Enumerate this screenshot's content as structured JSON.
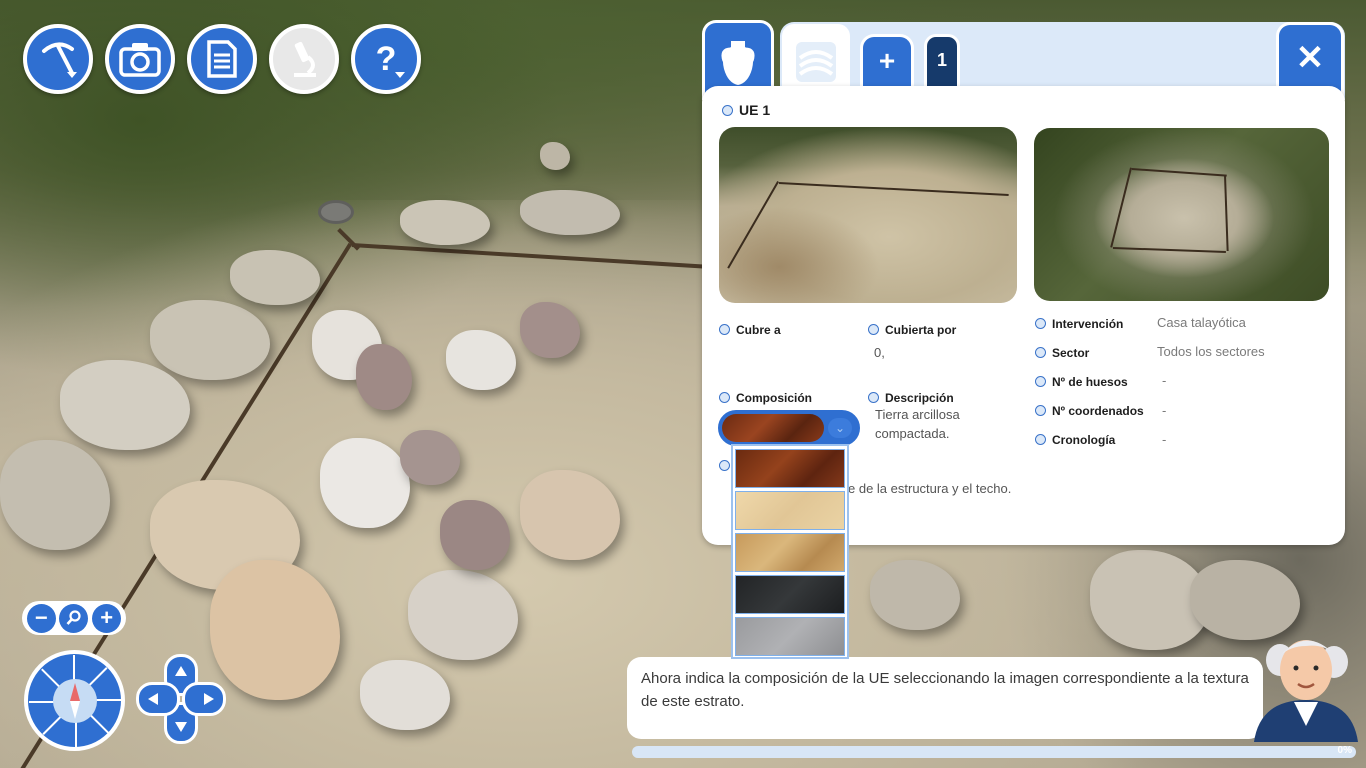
{
  "toolbar": {
    "excavate_icon": "pickaxe-icon",
    "camera_icon": "camera-icon",
    "records_icon": "document-icon",
    "microscope_icon": "microscope-icon",
    "help_icon": "question-icon",
    "help_label": "?"
  },
  "zoom": {
    "minus_label": "−",
    "plus_label": "+",
    "search_icon": "magnifier-icon"
  },
  "record_panel": {
    "tabs": {
      "ue_icon": "amphora-icon",
      "layers_icon": "layers-icon",
      "add_label": "+",
      "number_label": "1",
      "close_label": "✕"
    },
    "title": "UE 1",
    "fields": {
      "cubre_a": {
        "label": "Cubre a",
        "value": ""
      },
      "cubierta_por": {
        "label": "Cubierta por",
        "value": "0,"
      },
      "composicion": {
        "label": "Composición"
      },
      "descripcion": {
        "label": "Descripción",
        "value": "Tierra arcillosa compactada."
      },
      "interpretacion_fragment": "e de la estructura y el techo.",
      "intervencion": {
        "label": "Intervención",
        "value": "Casa talayótica"
      },
      "sector": {
        "label": "Sector",
        "value": "Todos los sectores"
      },
      "huesos": {
        "label": "Nº de huesos",
        "value": "-"
      },
      "coordenados": {
        "label": "Nº coordenados",
        "value": "-"
      },
      "cronologia": {
        "label": "Cronología",
        "value": "-"
      }
    },
    "composition_options": [
      {
        "name": "clay",
        "color": "#7a3415"
      },
      {
        "name": "sand",
        "color": "#e6cc9c"
      },
      {
        "name": "gravel",
        "color": "#c9a064"
      },
      {
        "name": "ash",
        "color": "#26282a"
      },
      {
        "name": "stone",
        "color": "#9c9da0"
      }
    ],
    "selected_composition": "clay"
  },
  "dialog": {
    "text": "Ahora indica la composición de la UE seleccionando la imagen correspondiente a la textura de este estrato."
  },
  "progress": {
    "value": 0,
    "label": "0%"
  },
  "colors": {
    "accent": "#2f6fd1",
    "panel_tab_bar": "#dce9f9",
    "dark_tab": "#163a6b"
  }
}
